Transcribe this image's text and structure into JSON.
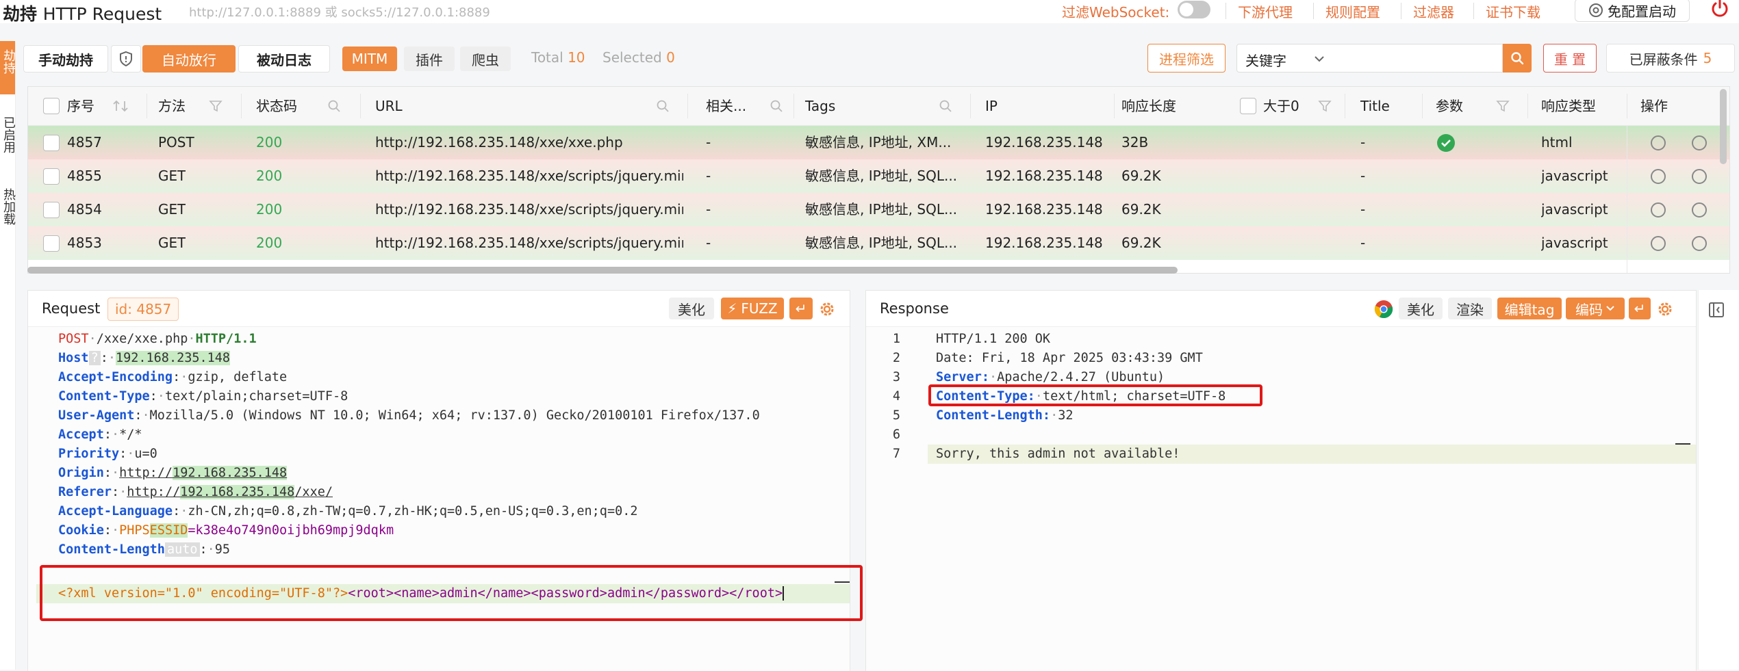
{
  "app": {
    "title_cn": "劫持",
    "title_en": "HTTP Request",
    "proxy_addr": "http://127.0.0.1:8889 或 socks5://127.0.0.1:8889"
  },
  "topnav": {
    "filter_ws": "过滤WebSocket:",
    "downstream_proxy": "下游代理",
    "rule_config": "规则配置",
    "filter": "过滤器",
    "cert_download": "证书下载",
    "free_config": "免配置启动"
  },
  "leftrail": {
    "tab1": "劫持",
    "tab2": "已启用",
    "tab3": "热加载"
  },
  "toolbar": {
    "manual": "手动劫持",
    "auto": "自动放行",
    "passive_log": "被动日志",
    "mitm": "MITM",
    "plugin": "插件",
    "crawler": "爬虫",
    "total_label": "Total",
    "total_value": "10",
    "selected_label": "Selected",
    "selected_value": "0",
    "process_filter": "进程筛选",
    "keyword_select": "关键字",
    "search_placeholder": "",
    "reset": "重 置",
    "blocked_label": "已屏蔽条件",
    "blocked_count": "5"
  },
  "table": {
    "headers": {
      "seq": "序号",
      "method": "方法",
      "status": "状态码",
      "url": "URL",
      "related": "相关...",
      "tags": "Tags",
      "ip": "IP",
      "resp_len": "响应长度",
      "gt0": "大于0",
      "title": "Title",
      "params": "参数",
      "resp_type": "响应类型",
      "ops": "操作"
    },
    "rows": [
      {
        "seq": "4857",
        "method": "POST",
        "status": "200",
        "url": "http://192.168.235.148/xxe/xxe.php",
        "related": "-",
        "tags": "敏感信息, IP地址, XM...",
        "ip": "192.168.235.148",
        "len": "32B",
        "title": "-",
        "type": "html"
      },
      {
        "seq": "4855",
        "method": "GET",
        "status": "200",
        "url": "http://192.168.235.148/xxe/scripts/jquery.min...",
        "related": "-",
        "tags": "敏感信息, IP地址, SQL...",
        "ip": "192.168.235.148",
        "len": "69.2K",
        "title": "-",
        "type": "javascript"
      },
      {
        "seq": "4854",
        "method": "GET",
        "status": "200",
        "url": "http://192.168.235.148/xxe/scripts/jquery.min...",
        "related": "-",
        "tags": "敏感信息, IP地址, SQL...",
        "ip": "192.168.235.148",
        "len": "69.2K",
        "title": "-",
        "type": "javascript"
      },
      {
        "seq": "4853",
        "method": "GET",
        "status": "200",
        "url": "http://192.168.235.148/xxe/scripts/jquery.min...",
        "related": "-",
        "tags": "敏感信息, IP地址, SQL...",
        "ip": "192.168.235.148",
        "len": "69.2K",
        "title": "-",
        "type": "javascript"
      }
    ]
  },
  "request": {
    "title": "Request",
    "id_label": "id: 4857",
    "beautify": "美化",
    "fuzz": "FUZZ",
    "lines": {
      "l1_method": "POST",
      "l1_path": "/xxe/xxe.php",
      "l1_proto": "HTTP/1.1",
      "host_k": "Host",
      "host_q": "?",
      "host_v": "192.168.235.148",
      "ae_k": "Accept-Encoding",
      "ae_v": "gzip, deflate",
      "ct_k": "Content-Type",
      "ct_v": "text/plain;charset=UTF-8",
      "ua_k": "User-Agent",
      "ua_v": "Mozilla/5.0 (Windows NT 10.0; Win64; x64; rv:137.0) Gecko/20100101 Firefox/137.0",
      "acc_k": "Accept",
      "acc_v": "*/*",
      "pri_k": "Priority",
      "pri_v": "u=0",
      "orig_k": "Origin",
      "orig_scheme": "http://",
      "orig_host": "192.168.235.148",
      "ref_k": "Referer",
      "ref_scheme": "http://",
      "ref_host": "192.168.235.148",
      "ref_path": "/xxe/",
      "al_k": "Accept-Language",
      "al_v": "zh-CN,zh;q=0.8,zh-TW;q=0.7,zh-HK;q=0.5,en-US;q=0.3,en;q=0.2",
      "ck_k": "Cookie",
      "ck_name1": "PHPS",
      "ck_name2": "ESSID",
      "ck_val": "=k38e4o749n0oijbh69mpj9dqkm",
      "cl_k": "Content-Length",
      "cl_auto": "auto",
      "cl_v": "95",
      "body_decl": "<?xml version=\"1.0\" encoding=\"UTF-8\"?>",
      "body_xml": "<root><name>admin</name><password>admin</password></root>"
    }
  },
  "response": {
    "title": "Response",
    "beautify": "美化",
    "render": "渲染",
    "edit_tag": "编辑tag",
    "encode": "编码",
    "line_numbers": [
      "1",
      "2",
      "3",
      "4",
      "5",
      "6",
      "7"
    ],
    "l1": "HTTP/1.1 200 OK",
    "l2": "Date: Fri, 18 Apr 2025 03:43:39 GMT",
    "l3_k": "Server:",
    "l3_v": "Apache/2.4.27 (Ubuntu)",
    "l4_k": "Content-Type:",
    "l4_v": "text/html; charset=UTF-8",
    "l5_k": "Content-Length:",
    "l5_v": "32",
    "l7": "Sorry, this admin not available!"
  },
  "colors": {
    "accent": "#f0883e",
    "link_orange": "#e8703a",
    "status_green": "#33a853",
    "highlight_red": "#e01818"
  }
}
